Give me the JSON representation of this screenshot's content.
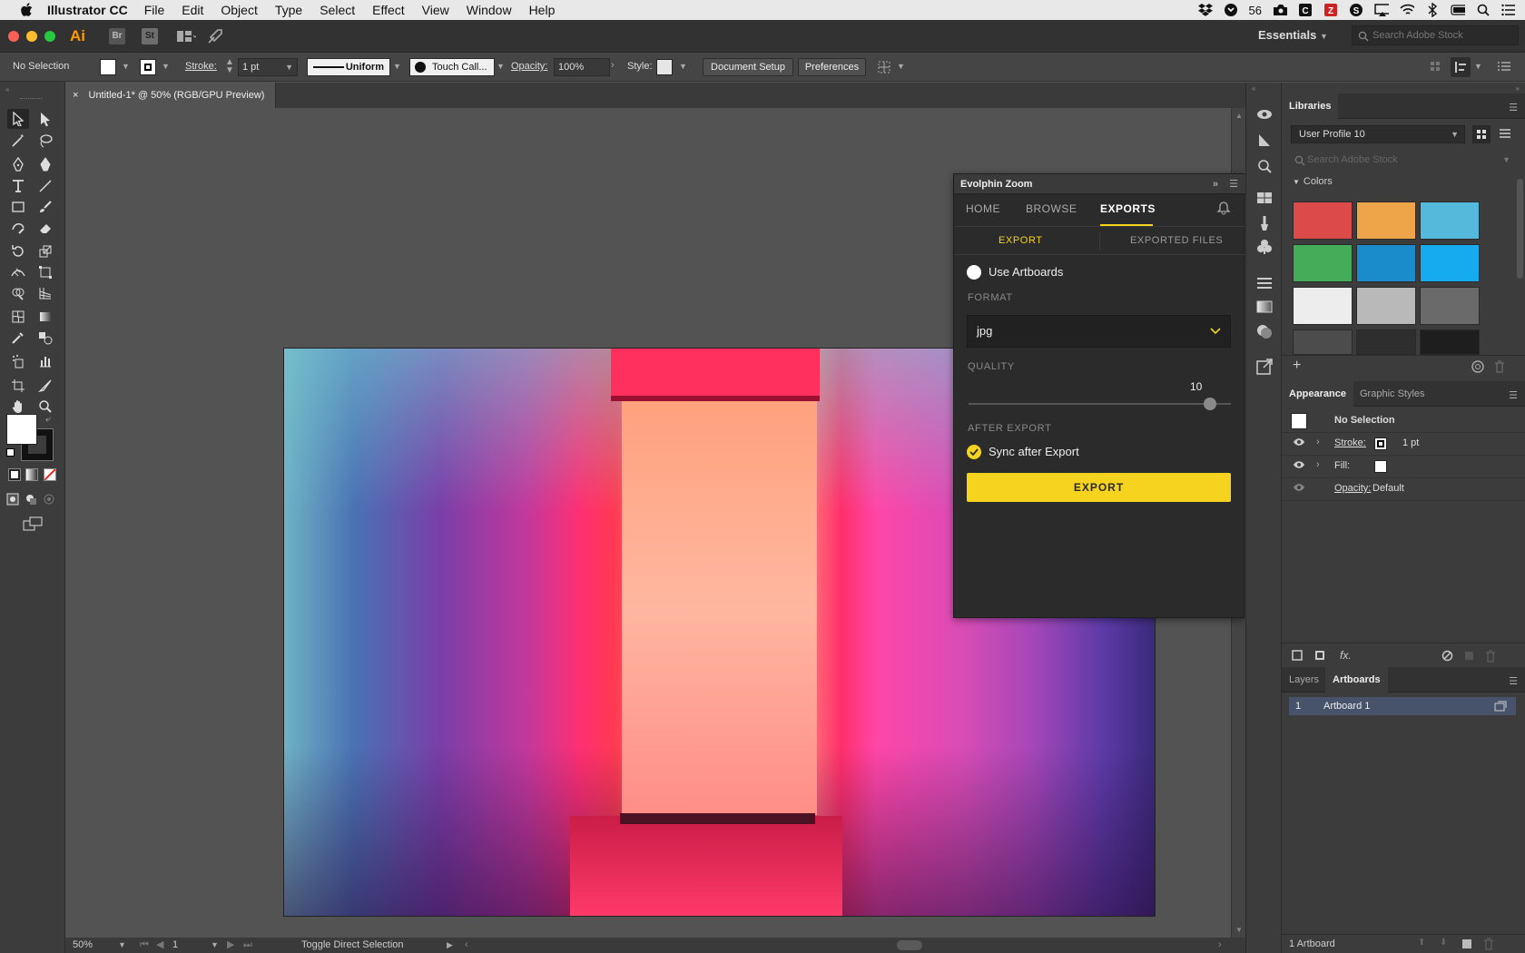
{
  "menubar": {
    "app_name": "Illustrator CC",
    "menus": [
      "File",
      "Edit",
      "Object",
      "Type",
      "Select",
      "Effect",
      "View",
      "Window",
      "Help"
    ],
    "status_count": "56"
  },
  "appbar": {
    "logo": "Ai",
    "bridge": "Br",
    "stock": "St",
    "workspace": "Essentials",
    "search_placeholder": "Search Adobe Stock"
  },
  "controlbar": {
    "selection": "No Selection",
    "stroke_label": "Stroke:",
    "stroke_value": "1 pt",
    "stroke_profile": "Uniform",
    "brush": "Touch Call...",
    "opacity_label": "Opacity:",
    "opacity_value": "100%",
    "style_label": "Style:",
    "document_setup": "Document Setup",
    "preferences": "Preferences"
  },
  "document": {
    "tab_title": "Untitled-1* @ 50% (RGB/GPU Preview)",
    "close_glyph": "×"
  },
  "statusbar": {
    "zoom": "50%",
    "artboard_num": "1",
    "status_text": "Toggle Direct Selection"
  },
  "ezpanel": {
    "title": "Evolphin Zoom",
    "nav": {
      "home": "HOME",
      "browse": "BROWSE",
      "exports": "EXPORTS"
    },
    "subtabs": {
      "export": "EXPORT",
      "exported_files": "EXPORTED FILES"
    },
    "use_artboards": "Use Artboards",
    "format_label": "FORMAT",
    "format_value": "jpg",
    "quality_label": "QUALITY",
    "quality_value": "10",
    "quality_fraction": 0.92,
    "after_export_label": "AFTER EXPORT",
    "sync_label": "Sync after Export",
    "export_button": "EXPORT"
  },
  "libraries": {
    "tab": "Libraries",
    "profile": "User Profile 10",
    "search_placeholder": "Search Adobe Stock",
    "colors_header": "Colors",
    "colors": [
      "#dc4a49",
      "#eea448",
      "#55b9dc",
      "#45ad59",
      "#1b8ccb",
      "#16aaef",
      "#ededed",
      "#b9b9b9",
      "#6a6a6a",
      "#4c4c4c",
      "#2e2e2e",
      "#1e1e1e"
    ]
  },
  "appearance": {
    "tab_appearance": "Appearance",
    "tab_styles": "Graphic Styles",
    "selection": "No Selection",
    "stroke_label": "Stroke:",
    "stroke_value": "1 pt",
    "fill_label": "Fill:",
    "opacity_label": "Opacity:",
    "opacity_value": "Default",
    "fx": "fx."
  },
  "artboards": {
    "tab_layers": "Layers",
    "tab_artboards": "Artboards",
    "row_num": "1",
    "row_name": "Artboard 1",
    "footer": "1 Artboard"
  }
}
